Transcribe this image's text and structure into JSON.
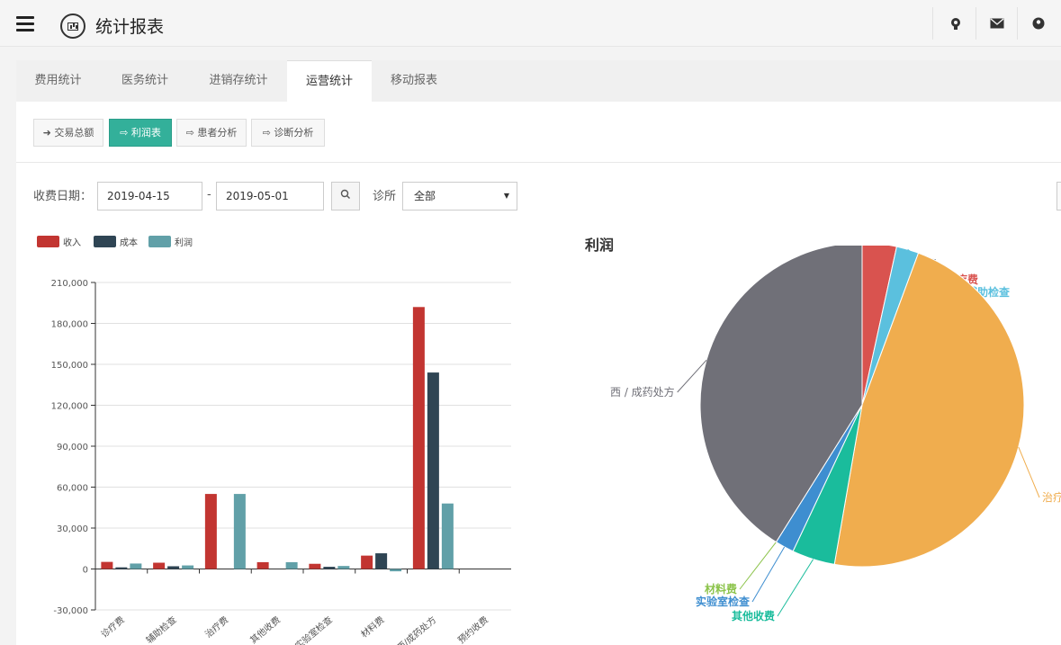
{
  "header": {
    "title": "统计报表"
  },
  "tabs": [
    {
      "label": "费用统计",
      "active": false
    },
    {
      "label": "医务统计",
      "active": false
    },
    {
      "label": "进销存统计",
      "active": false
    },
    {
      "label": "运营统计",
      "active": true
    },
    {
      "label": "移动报表",
      "active": false
    }
  ],
  "subtabs": [
    {
      "label": "交易总额",
      "icon": "sign-in-icon",
      "active": false
    },
    {
      "label": "利润表",
      "icon": "sign-out-icon",
      "active": true
    },
    {
      "label": "患者分析",
      "icon": "sign-out-icon",
      "active": false
    },
    {
      "label": "诊断分析",
      "icon": "sign-out-icon",
      "active": false
    }
  ],
  "filters": {
    "date_label": "收费日期：",
    "start_date": "2019-04-15",
    "dash": "-",
    "end_date": "2019-05-01",
    "clinic_label": "诊所",
    "clinic_value": "全部"
  },
  "chart_data": [
    {
      "type": "bar",
      "title": "",
      "legend": [
        "收入",
        "成本",
        "利润"
      ],
      "categories": [
        "诊疗费",
        "辅助检查",
        "治疗费",
        "其他收费",
        "实验室检查",
        "材料费",
        "西/成药处方",
        "预约收费"
      ],
      "series": [
        {
          "name": "收入",
          "color": "#c23531",
          "values": [
            5200,
            4600,
            55000,
            5000,
            3800,
            9800,
            192000,
            0
          ]
        },
        {
          "name": "成本",
          "color": "#2f4554",
          "values": [
            1200,
            2000,
            0,
            0,
            1600,
            11500,
            144000,
            0
          ]
        },
        {
          "name": "利润",
          "color": "#61a0a8",
          "values": [
            4000,
            2600,
            55000,
            5000,
            2200,
            -1700,
            48000,
            0
          ]
        }
      ],
      "yticks": [
        "210,000",
        "180,000",
        "150,000",
        "120,000",
        "90,000",
        "60,000",
        "30,000",
        "0",
        "-30,000"
      ],
      "ylim": [
        -30000,
        210000
      ]
    },
    {
      "type": "pie",
      "title": "利润",
      "slices": [
        {
          "name": "预约收费",
          "value": 0,
          "color": "#2f4554"
        },
        {
          "name": "诊疗费",
          "value": 4000,
          "color": "#d9534f"
        },
        {
          "name": "辅助检查",
          "value": 2600,
          "color": "#5bc0de"
        },
        {
          "name": "治疗费",
          "value": 55000,
          "color": "#f0ad4e"
        },
        {
          "name": "其他收费",
          "value": 5000,
          "color": "#1abc9c"
        },
        {
          "name": "实验室检查",
          "value": 2200,
          "color": "#3e8ed0"
        },
        {
          "name": "材料费",
          "value": 0,
          "color": "#8bc34a"
        },
        {
          "name": "西 / 成药处方",
          "value": 48000,
          "color": "#707078"
        }
      ]
    }
  ]
}
